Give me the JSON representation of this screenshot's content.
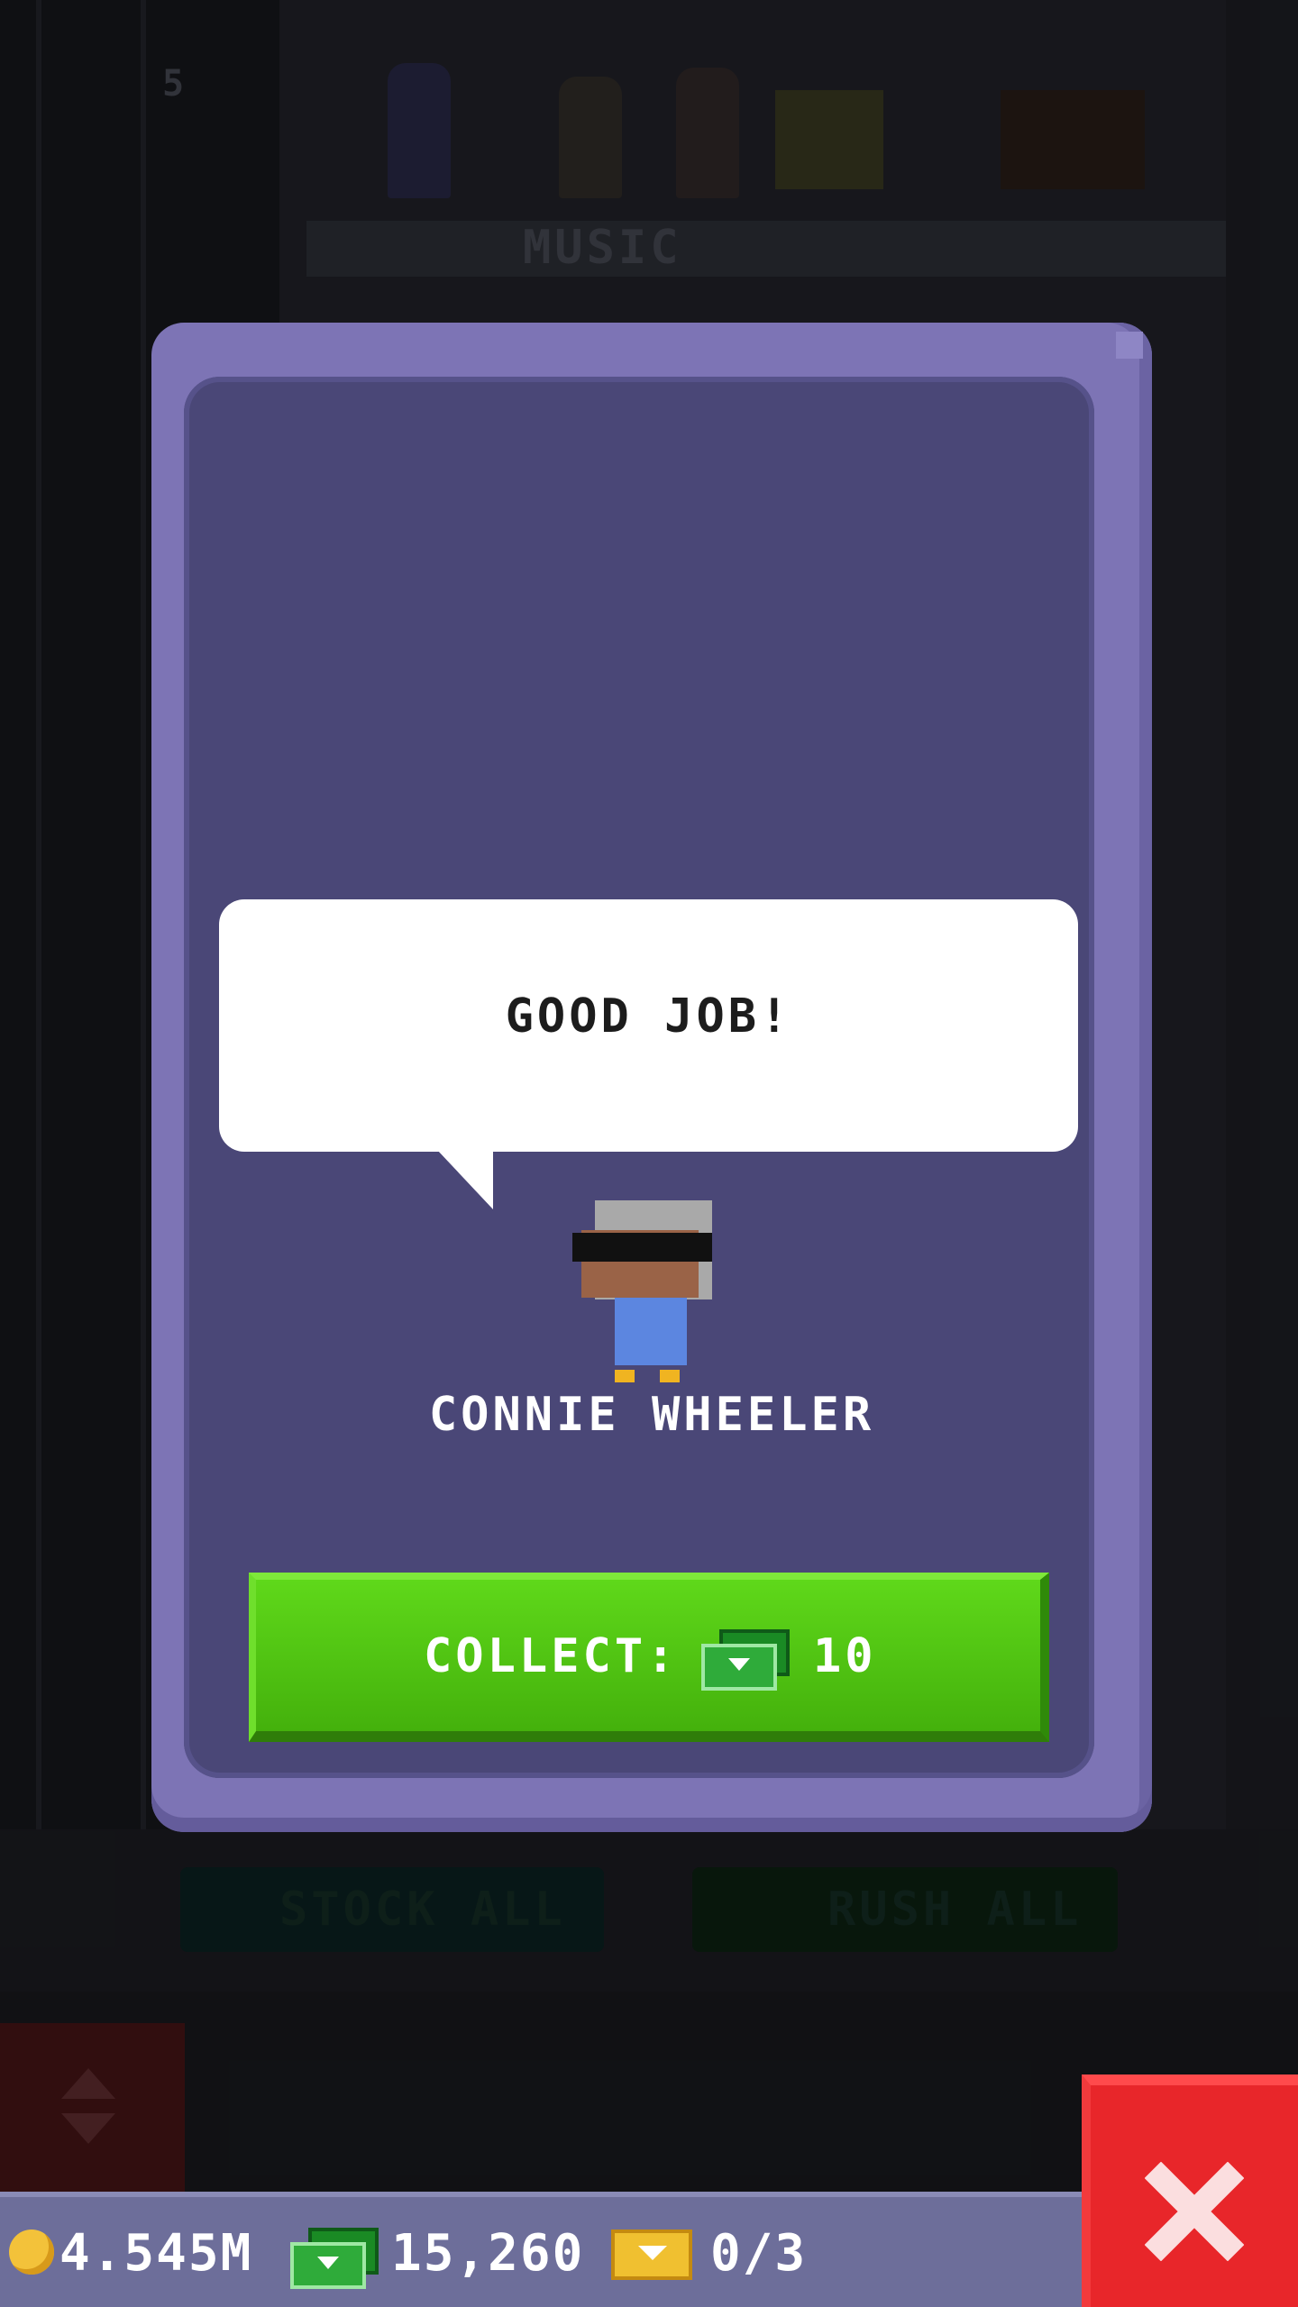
{
  "background": {
    "floor_label": "MUSIC",
    "floor_number": "5",
    "stock_all_label": "STOCK ALL",
    "rush_all_label": "RUSH ALL"
  },
  "dialog": {
    "speech": "GOOD JOB!",
    "character_name": "CONNIE WHEELER",
    "collect_label": "COLLECT:",
    "collect_amount": "10"
  },
  "status_bar": {
    "coins": "4.545M",
    "bux": "15,260",
    "tickets": "0/3"
  },
  "colors": {
    "modal_frame": "#7d74b5",
    "modal_body": "#4a4777",
    "collect_button": "#4fc413",
    "close_button": "#e8262a",
    "status_bar": "#6d6e9a"
  },
  "icons": {
    "coin": "coin-icon",
    "bux": "bux-icon",
    "ticket": "ticket-icon",
    "close": "close-icon",
    "elevator": "elevator-icon"
  }
}
